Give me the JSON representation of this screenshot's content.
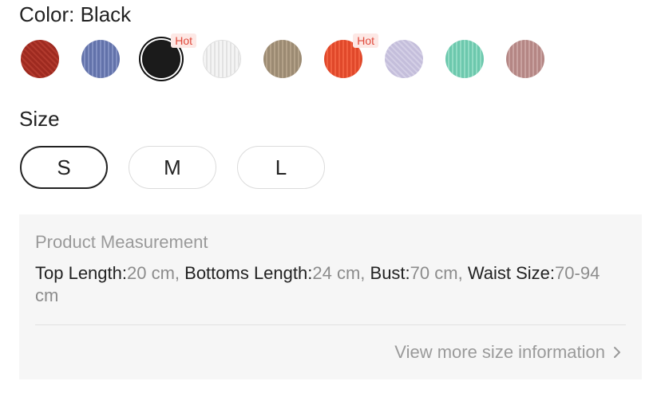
{
  "color_section": {
    "label": "Color: Black",
    "swatches": [
      {
        "name": "dark-red",
        "color": "#9e2a20"
      },
      {
        "name": "blue",
        "color": "#6c7cb2"
      },
      {
        "name": "black",
        "color": "#141414",
        "selected": true,
        "hot": "Hot"
      },
      {
        "name": "white",
        "color": "#efefef"
      },
      {
        "name": "khaki",
        "color": "#9b8a72"
      },
      {
        "name": "orange",
        "color": "#e0482a",
        "hot": "Hot"
      },
      {
        "name": "lavender",
        "color": "#c4bedb"
      },
      {
        "name": "mint",
        "color": "#76cdb3"
      },
      {
        "name": "dusty-pink",
        "color": "#b48684"
      }
    ]
  },
  "size_section": {
    "label": "Size",
    "options": [
      "S",
      "M",
      "L"
    ],
    "selected": "S"
  },
  "measurement": {
    "title": "Product Measurement",
    "top_length_label": "Top Length:",
    "top_length_value": "20 cm",
    "bottoms_length_label": "Bottoms Length:",
    "bottoms_length_value": "24 cm",
    "bust_label": "Bust:",
    "bust_value": "70 cm",
    "waist_label": "Waist Size:",
    "waist_value": "70-94 cm",
    "view_more": "View more size information"
  },
  "colors": {
    "hot_text": "#e0493b",
    "hot_bg": "#fde8e5",
    "panel_bg": "#f6f6f6"
  }
}
